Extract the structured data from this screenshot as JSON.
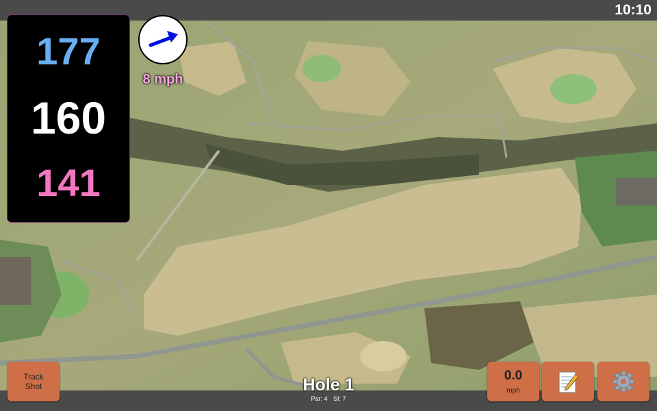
{
  "status": {
    "clock": "10:10"
  },
  "distances": {
    "back": "177",
    "middle": "160",
    "front": "141"
  },
  "wind": {
    "speed_label": "8 mph",
    "direction_icon": "wind-arrow-icon"
  },
  "buttons": {
    "track_shot": {
      "line1": "Track",
      "line2": "Shot"
    },
    "speed": {
      "value": "0.0",
      "unit": "mph"
    },
    "notes_icon": "notepad-icon",
    "settings_icon": "gear-icon"
  },
  "hole": {
    "title": "Hole 1",
    "par": "Par: 4",
    "si": "SI: 7"
  },
  "colors": {
    "back": "#6aaef2",
    "middle": "#ffffff",
    "front": "#f277c0",
    "button": "#cf6f47",
    "wind_label": "#f7a6df"
  }
}
